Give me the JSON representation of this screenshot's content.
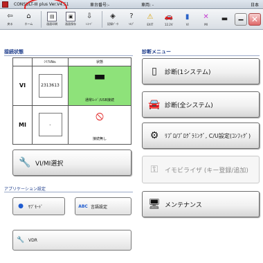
{
  "window": {
    "title": "CONSULT-III plus Ver.V4.51",
    "case_number_label": "車台番号:-",
    "vehicle_label": "車両:  -",
    "country": "日本"
  },
  "toolbar": {
    "items": [
      {
        "label": "戻る",
        "icon": "back-arrow-icon"
      },
      {
        "label": "ホーム",
        "icon": "home-icon"
      },
      {
        "label": "画面印刷",
        "icon": "print-screen-icon"
      },
      {
        "label": "画面保存",
        "icon": "screen-capture-icon"
      },
      {
        "label": "ﾚｺｰﾄﾞ",
        "icon": "recorder-icon"
      },
      {
        "label": "記録ﾃﾞｰﾀ",
        "icon": "recorded-data-icon"
      },
      {
        "label": "ﾍﾙﾌﾟ",
        "icon": "help-icon"
      },
      {
        "label": "EXIT",
        "icon": "warning-exit-icon"
      },
      {
        "label": "12.2V",
        "icon": "battery-voltage-icon"
      },
      {
        "label": "VI",
        "icon": "vi-connected-icon"
      },
      {
        "label": "MI",
        "icon": "mi-disconnected-icon"
      }
    ],
    "voltage": "12.2V"
  },
  "connection": {
    "title": "接続状態",
    "col_serial": "ｼﾘｱﾙNo.",
    "col_state": "状態",
    "rows": [
      {
        "name": "VI",
        "serial": "2313613",
        "state": "通常ﾓｰﾄﾞ/USB接続",
        "state_color": "#8ee27a"
      },
      {
        "name": "MI",
        "serial": "-",
        "state": "接続無し",
        "state_color": "#ffffff"
      }
    ]
  },
  "vi_mi_select": {
    "label": "VI/MI選択"
  },
  "app_settings": {
    "title": "アプリケーション設定",
    "sub_mode_label": "ｻﾌﾞﾓｰﾄﾞ",
    "language_label": "言語設定",
    "vdr_label": "VDR"
  },
  "diagnosis_menu": {
    "title": "診断メニュー",
    "items": [
      {
        "label": "診断(1システム)",
        "enabled": true
      },
      {
        "label": "診断(全システム)",
        "enabled": true
      },
      {
        "label": "ﾘﾌﾟﾛ/ﾌﾟﾛｸﾞﾗﾐﾝｸﾞ, C/U設定(ｺﾝﾌｨｸﾞ)",
        "enabled": true
      },
      {
        "label": "イモビライザ (キー登録/追加)",
        "enabled": false
      },
      {
        "label": "メンテナンス",
        "enabled": true
      }
    ]
  },
  "annotation": {
    "color": "#e02020"
  }
}
